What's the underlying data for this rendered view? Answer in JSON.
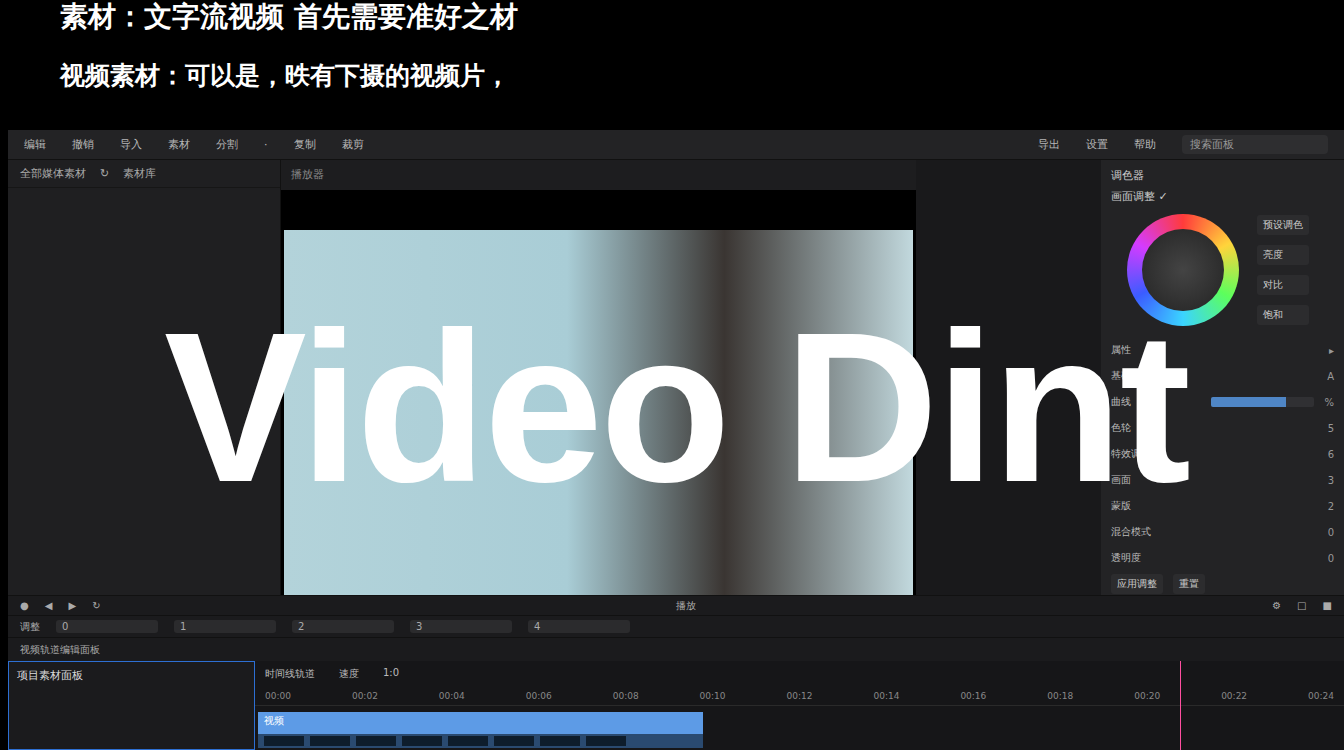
{
  "slide": {
    "title": "素材：文字流视频 首先需要准好之材",
    "subtitle": "视频素材：可以是，昳有下摄的视频片，"
  },
  "overlay": {
    "text": "Video Dint"
  },
  "toolbar": {
    "left": [
      "编辑",
      "撤销",
      "导入",
      "素材",
      "分割",
      "·",
      "复制",
      "裁剪"
    ],
    "right": [
      "导出",
      "设置",
      "帮助"
    ],
    "search": "搜索面板"
  },
  "media_panel": {
    "tab": "全部媒体素材",
    "icon": "↻",
    "label": "素材库"
  },
  "preview": {
    "header": "播放器"
  },
  "inspector": {
    "title": "调色器",
    "section": "画面调整 ✓",
    "buttons": [
      "预设调色",
      "亮度",
      "对比",
      "饱和"
    ],
    "rows": [
      {
        "label": "属性",
        "value": "▸",
        "kind": "text"
      },
      {
        "label": "基础调整",
        "value": "A",
        "kind": "text"
      },
      {
        "label": "曲线",
        "value": "%",
        "kind": "slider",
        "level": 0.72
      },
      {
        "label": "色轮",
        "value": "5",
        "kind": "text"
      },
      {
        "label": "特效调整",
        "value": "6",
        "kind": "text"
      },
      {
        "label": "画面",
        "value": "3",
        "kind": "text"
      },
      {
        "label": "蒙版",
        "value": "2",
        "kind": "text"
      },
      {
        "label": "混合模式",
        "value": "0",
        "kind": "text"
      },
      {
        "label": "透明度",
        "value": "0",
        "kind": "text"
      }
    ],
    "footer": [
      "应用调整",
      "重置"
    ]
  },
  "playback": {
    "left": [
      "●",
      "◀",
      "▶",
      "↻"
    ],
    "center": "播放",
    "right": [
      "⚙",
      "□",
      "■"
    ]
  },
  "edit_row": {
    "label": "调整",
    "fields": [
      "0",
      "1",
      "2",
      "3",
      "4"
    ]
  },
  "track_row": {
    "label": "视频轨道编辑面板"
  },
  "timeline": {
    "panel_title": "项目素材面板",
    "header": [
      "时间线轨道",
      "速度",
      "1:0"
    ],
    "ruler": [
      "00:00",
      "00:02",
      "00:04",
      "00:06",
      "00:08",
      "00:10",
      "00:12",
      "00:14",
      "00:16",
      "00:18",
      "00:20",
      "00:22",
      "00:24"
    ],
    "clip": "视频",
    "clip_level": 0.41
  }
}
